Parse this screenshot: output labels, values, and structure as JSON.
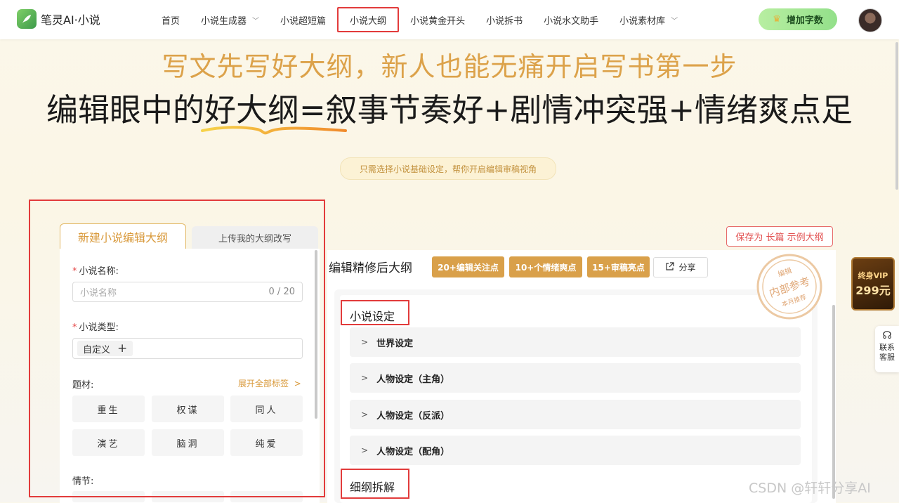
{
  "header": {
    "logo_text": "笔灵AI·小说",
    "nav": [
      {
        "label": "首页",
        "dropdown": false
      },
      {
        "label": "小说生成器",
        "dropdown": true
      },
      {
        "label": "小说超短篇",
        "dropdown": false
      },
      {
        "label": "小说大纲",
        "dropdown": false,
        "active": true
      },
      {
        "label": "小说黄金开头",
        "dropdown": false
      },
      {
        "label": "小说拆书",
        "dropdown": false
      },
      {
        "label": "小说水文助手",
        "dropdown": false
      },
      {
        "label": "小说素材库",
        "dropdown": true
      }
    ],
    "add_words_label": "增加字数"
  },
  "hero": {
    "line1": "写文先写好大纲，新人也能无痛开启写书第一步",
    "line2": "编辑眼中的好大纲=叙事节奏好+剧情冲突强+情绪爽点足",
    "subtitle": "只需选择小说基础设定，帮你开启编辑审稿视角"
  },
  "left_panel": {
    "tab_new": "新建小说编辑大纲",
    "tab_upload": "上传我的大纲改写",
    "name_label": "小说名称:",
    "name_placeholder": "小说名称",
    "name_counter": "0 / 20",
    "type_label": "小说类型:",
    "type_chip": "自定义",
    "theme_label": "题材:",
    "expand_all": "展开全部标签",
    "themes": [
      "重生",
      "权谋",
      "同人",
      "演艺",
      "脑洞",
      "纯爱"
    ],
    "plot_label": "情节:"
  },
  "right_panel": {
    "save_button": "保存为 长篇 示例大纲",
    "title": "编辑精修后大纲",
    "badges": [
      "20+编辑关注点",
      "10+个情绪爽点",
      "15+审稿亮点"
    ],
    "share": "分享",
    "stamp": {
      "top": "编辑",
      "main": "内部参考",
      "bottom": "本月推荐"
    },
    "section_setting": "小说设定",
    "rows": [
      "世界设定",
      "人物设定（主角）",
      "人物设定（反派）",
      "人物设定（配角）"
    ],
    "section_outline": "细纲拆解"
  },
  "side": {
    "vip_line1": "终身VIP",
    "vip_line2": "299元",
    "contact": "联系客服"
  },
  "watermark": "CSDN @轩轩分享AI",
  "colors": {
    "accent_gold": "#d9a04a",
    "highlight_red": "#e23b3b",
    "brand_green": "#93e08a"
  }
}
